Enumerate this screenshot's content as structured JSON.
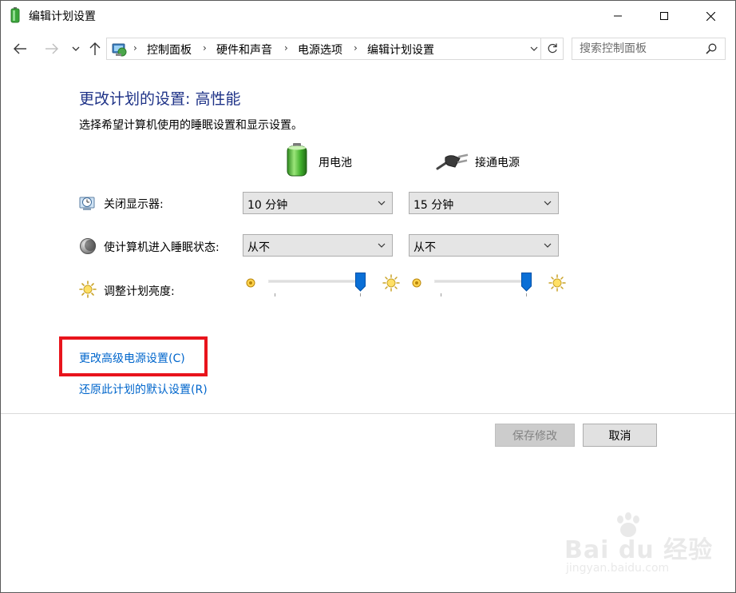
{
  "window": {
    "title": "编辑计划设置",
    "icon": "power-options-icon"
  },
  "nav": {
    "breadcrumbs": [
      "控制面板",
      "硬件和声音",
      "电源选项",
      "编辑计划设置"
    ],
    "search_placeholder": "搜索控制面板"
  },
  "main": {
    "title": "更改计划的设置: 高性能",
    "description": "选择希望计算机使用的睡眠设置和显示设置。",
    "columns": {
      "battery": "用电池",
      "plugged": "接通电源"
    },
    "rows": {
      "display_off": {
        "label": "关闭显示器:",
        "battery_value": "10 分钟",
        "plugged_value": "15 分钟"
      },
      "sleep": {
        "label": "使计算机进入睡眠状态:",
        "battery_value": "从不",
        "plugged_value": "从不"
      },
      "brightness": {
        "label": "调整计划亮度:",
        "battery_level": 1.0,
        "plugged_level": 1.0
      }
    },
    "links": {
      "advanced": "更改高级电源设置(C)",
      "restore": "还原此计划的默认设置(R)"
    },
    "buttons": {
      "save": "保存修改",
      "cancel": "取消"
    }
  },
  "watermark": {
    "brand": "Bai du 经验",
    "url": "jingyan.baidu.com"
  },
  "colors": {
    "title_blue": "#1e3287",
    "link_blue": "#0066cc",
    "highlight_red": "#e8141c",
    "slider_thumb": "#0a6fd6"
  }
}
